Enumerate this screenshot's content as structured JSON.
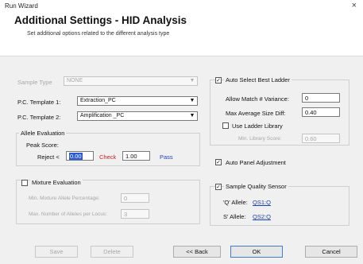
{
  "window": {
    "title": "Run Wizard",
    "close_glyph": "×"
  },
  "header": {
    "title": "Additional Settings - HID Analysis",
    "subtitle": "Set additional options related to the different analysis type"
  },
  "left": {
    "top_label": "Sample Type",
    "top_value": "NONE",
    "pc1_label": "P.C. Template 1:",
    "pc1_value": "Extraction_PC",
    "pc2_label": "P.C. Template 2:",
    "pc2_value": "Amplification _PC",
    "allele": {
      "group_label": "Allele Evaluation",
      "peak_label": "Peak Score:",
      "reject_label": "Reject <",
      "reject_value": "0.00",
      "check_label": "Check",
      "check_value": "1.00",
      "pass_label": "Pass"
    },
    "mixture": {
      "check_label": "Mixture Evaluation",
      "field1_label": "Min. Mixture Allele Percentage:",
      "field1_value": "0",
      "field2_label": "Max. Number of Alleles per Locus:",
      "field2_value": "3"
    }
  },
  "right": {
    "auto_ladder_label": "Auto Select Best Ladder",
    "allow_match_label": "Allow Match # Variance:",
    "allow_match_value": "0",
    "max_avg_label": "Max Average Size Diff:",
    "max_avg_value": "0.40",
    "use_library_label": "Use Ladder Library",
    "library_sub_label": "Min. Library Score:",
    "library_sub_value": "0.60",
    "auto_panel_label": "Auto Panel Adjustment",
    "sqs_label": "Sample Quality Sensor",
    "q_allele_label": "'Q' Allele:",
    "q_allele_link": "QS1:Q",
    "s_allele_label": "S' Allele:",
    "s_allele_link": "QS2:Q"
  },
  "buttons": {
    "left1": "Save",
    "left2": "Delete",
    "back": "<< Back",
    "ok": "OK",
    "cancel": "Cancel"
  },
  "checks": {
    "checked_glyph": "✓"
  }
}
